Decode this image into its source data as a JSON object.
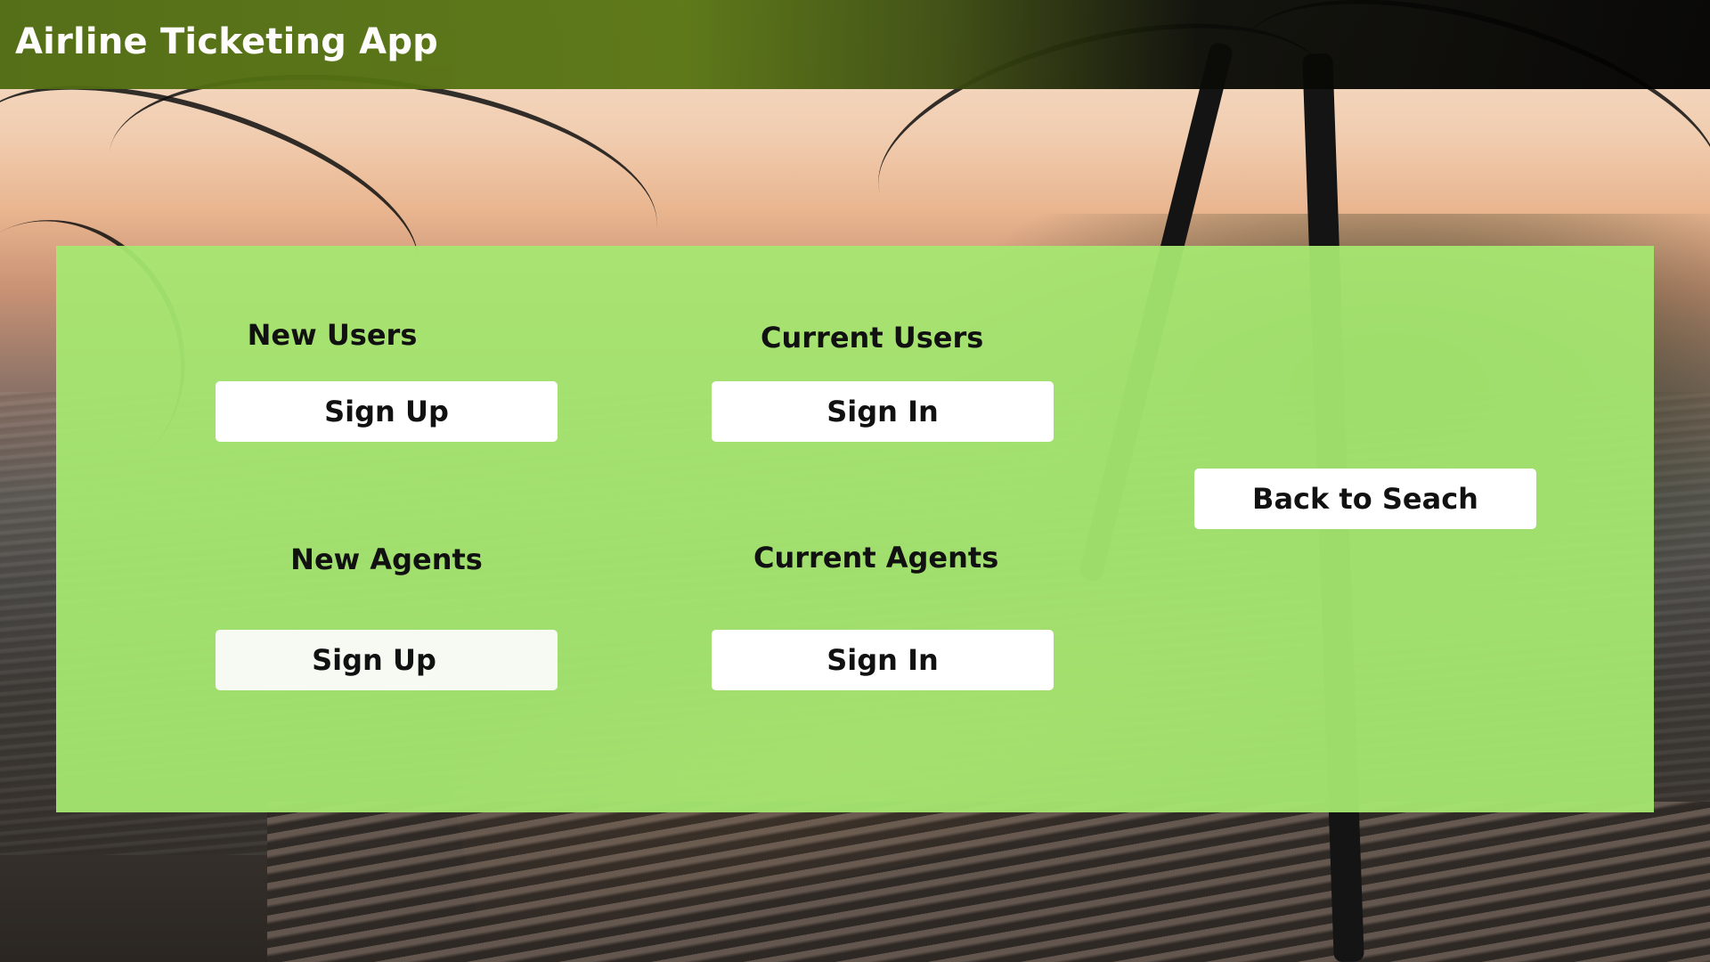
{
  "header": {
    "app_title": "Airline Ticketing App"
  },
  "panel": {
    "new_users": {
      "label": "New Users",
      "button": "Sign Up"
    },
    "current_users": {
      "label": "Current Users",
      "button": "Sign In"
    },
    "new_agents": {
      "label": "New Agents",
      "button": "Sign Up"
    },
    "current_agents": {
      "label": "Current Agents",
      "button": "Sign In"
    },
    "back_button": "Back to Seach"
  },
  "colors": {
    "panel_green": "#a6e871",
    "header_green": "#587513",
    "button_bg": "#ffffff",
    "text": "#111111"
  }
}
